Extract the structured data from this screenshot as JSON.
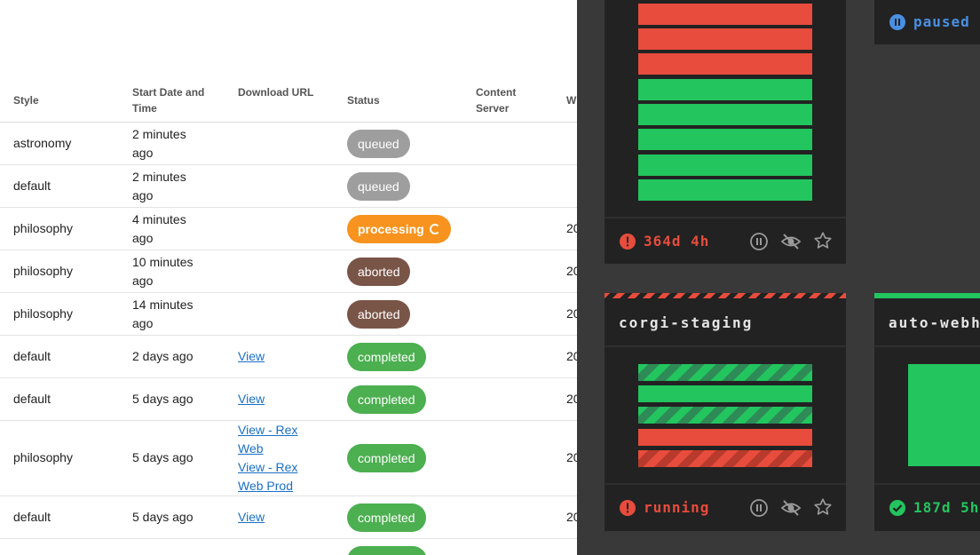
{
  "table": {
    "headers": {
      "style": "Style",
      "start_1": "Start Date and",
      "start_2": "Time",
      "download": "Download URL",
      "status": "Status",
      "content_1": "Content",
      "content_2": "Server",
      "w": "W"
    },
    "rows": [
      {
        "style": "astronomy",
        "date_1": "2 minutes",
        "date_2": "ago",
        "status": "queued",
        "w": ""
      },
      {
        "style": "default",
        "date_1": "2 minutes",
        "date_2": "ago",
        "status": "queued",
        "w": ""
      },
      {
        "style": "philosophy",
        "date_1": "4 minutes",
        "date_2": "ago",
        "status": "processing",
        "w": "20"
      },
      {
        "style": "philosophy",
        "date_1": "10 minutes",
        "date_2": "ago",
        "status": "aborted",
        "w": "20"
      },
      {
        "style": "philosophy",
        "date_1": "14 minutes",
        "date_2": "ago",
        "status": "aborted",
        "w": "20"
      },
      {
        "style": "default",
        "date_1": "2 days ago",
        "link_1": "View",
        "status": "completed",
        "w": "20"
      },
      {
        "style": "default",
        "date_1": "5 days ago",
        "link_1": "View",
        "status": "completed",
        "w": "20"
      },
      {
        "style": "philosophy",
        "date_1": "5 days ago",
        "link_1": "View - Rex",
        "link_1b": "Web",
        "link_2": "View - Rex",
        "link_2b": "Web Prod",
        "status": "completed",
        "w": "20"
      },
      {
        "style": "default",
        "date_1": "5 days ago",
        "link_1": "View",
        "status": "completed",
        "w": "20"
      }
    ],
    "status_colors": {
      "queued": "#9e9e9e",
      "processing": "#f7931e",
      "aborted": "#795548",
      "completed": "#4caf50"
    }
  },
  "dashboard": {
    "card1": {
      "footer_text": "364d 4h",
      "footer_color": "#e74c3c",
      "bars": [
        "red",
        "red",
        "red",
        "green",
        "green",
        "green",
        "green",
        "green"
      ]
    },
    "card2": {
      "status_text": "paused",
      "status_color": "#4a90e2"
    },
    "card3": {
      "title": "corgi-staging",
      "footer_text": "running",
      "footer_color": "#e74c3c",
      "bars": [
        "green-stripe",
        "green",
        "green-stripe",
        "red",
        "red-stripe"
      ]
    },
    "card4": {
      "title": "auto-webho",
      "footer_text": "187d 5h",
      "footer_color": "#22c55e"
    },
    "icons": [
      "pause-icon",
      "eye-slash-icon",
      "star-icon"
    ]
  }
}
